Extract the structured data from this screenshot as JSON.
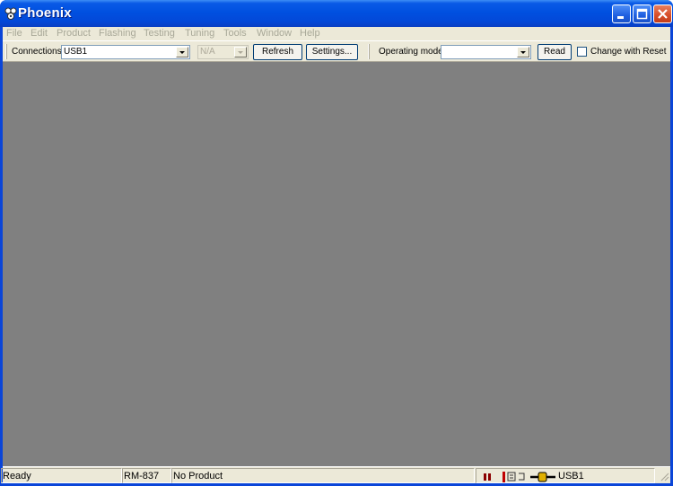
{
  "window": {
    "title": "Phoenix"
  },
  "menu": {
    "items": [
      "File",
      "Edit",
      "Product",
      "Flashing",
      "Testing",
      "Tuning",
      "Tools",
      "Window",
      "Help"
    ]
  },
  "toolbar": {
    "connections_label": "Connections:",
    "connections_value": "USB1",
    "na_value": "N/A",
    "refresh_label": "Refresh",
    "settings_label": "Settings...",
    "operating_mode_label": "Operating mode:",
    "operating_mode_value": "",
    "read_label": "Read",
    "change_with_reset_label": "Change with Reset",
    "change_with_reset_checked": false
  },
  "statusbar": {
    "status": "Ready",
    "product_code": "RM-837",
    "product_name": "No Product",
    "connection": "USB1"
  },
  "colors": {
    "titlebar": "#0050e0",
    "workspace": "#808080",
    "chrome": "#ece9d8"
  }
}
